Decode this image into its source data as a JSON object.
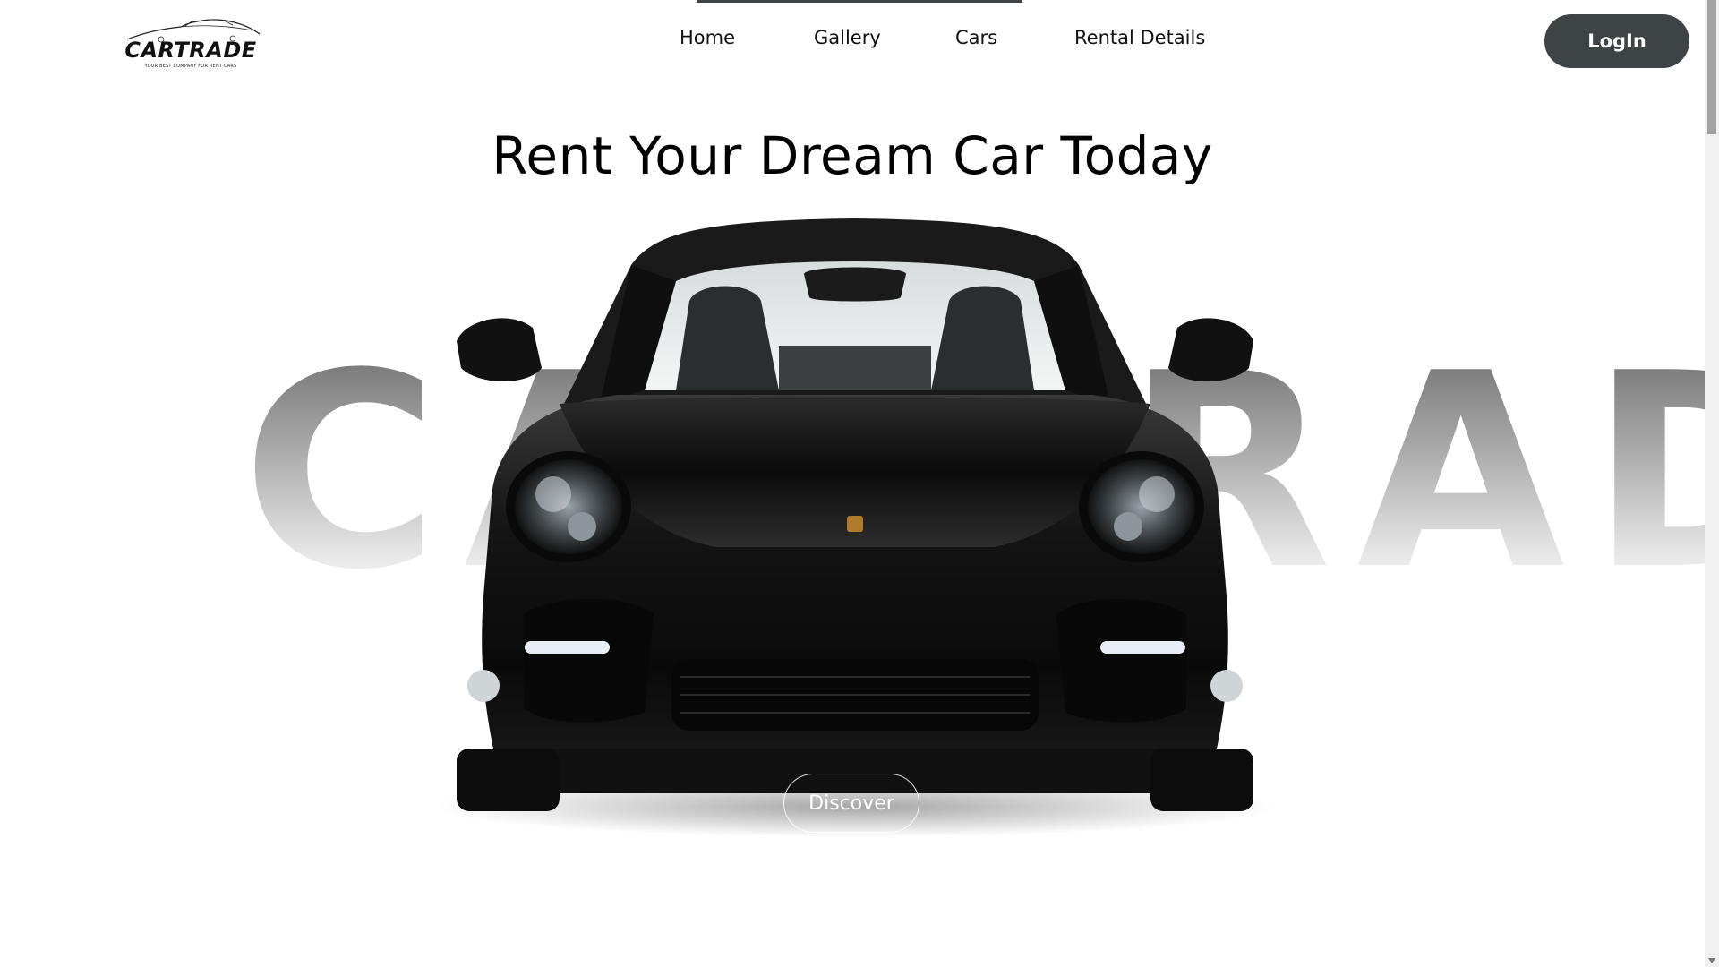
{
  "header": {
    "logo": {
      "brand": "CARTRADE",
      "tagline": "YOUR BEST COMPANY FOR RENT CARS"
    },
    "nav": [
      {
        "label": "Home"
      },
      {
        "label": "Gallery"
      },
      {
        "label": "Cars"
      },
      {
        "label": "Rental Details"
      }
    ],
    "login_label": "LogIn"
  },
  "hero": {
    "title": "Rent Your Dream Car Today",
    "background_word": "CARTRADE",
    "discover_label": "Discover"
  },
  "colors": {
    "accent_dark": "#3e4346",
    "text": "#111111",
    "background": "#ffffff"
  },
  "icons": [
    "car-logo-icon",
    "porsche-badge-icon"
  ]
}
